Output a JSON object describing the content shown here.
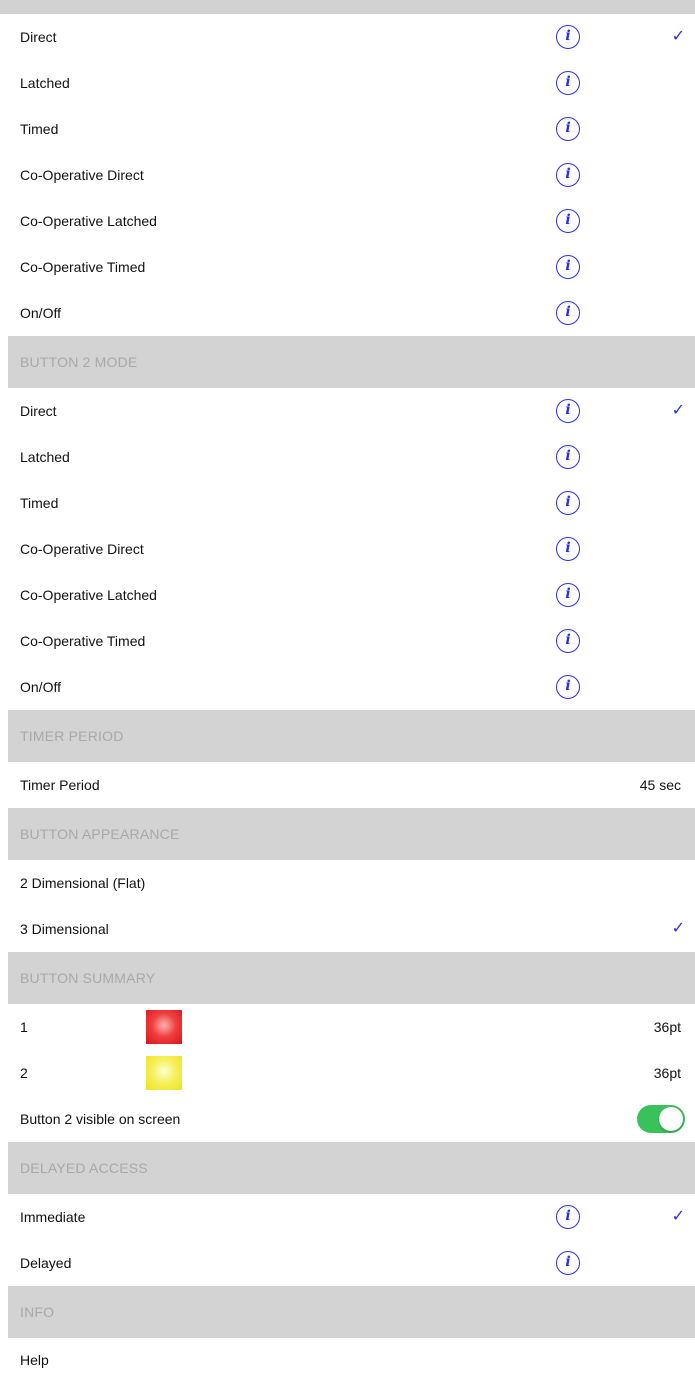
{
  "button1_mode": {
    "items": [
      {
        "label": "Direct",
        "checked": true
      },
      {
        "label": "Latched",
        "checked": false
      },
      {
        "label": "Timed",
        "checked": false
      },
      {
        "label": "Co-Operative Direct",
        "checked": false
      },
      {
        "label": "Co-Operative Latched",
        "checked": false
      },
      {
        "label": "Co-Operative Timed",
        "checked": false
      },
      {
        "label": "On/Off",
        "checked": false
      }
    ]
  },
  "button2_mode": {
    "header": "BUTTON 2 MODE",
    "items": [
      {
        "label": "Direct",
        "checked": true
      },
      {
        "label": "Latched",
        "checked": false
      },
      {
        "label": "Timed",
        "checked": false
      },
      {
        "label": "Co-Operative Direct",
        "checked": false
      },
      {
        "label": "Co-Operative Latched",
        "checked": false
      },
      {
        "label": "Co-Operative Timed",
        "checked": false
      },
      {
        "label": "On/Off",
        "checked": false
      }
    ]
  },
  "timer_period": {
    "header": "TIMER PERIOD",
    "label": "Timer Period",
    "value": "45 sec"
  },
  "button_appearance": {
    "header": "BUTTON APPEARANCE",
    "items": [
      {
        "label": "2 Dimensional (Flat)",
        "checked": false
      },
      {
        "label": "3 Dimensional",
        "checked": true
      }
    ]
  },
  "button_summary": {
    "header": "BUTTON SUMMARY",
    "buttons": [
      {
        "label": "1",
        "size": "36pt",
        "color": "#e8232a"
      },
      {
        "label": "2",
        "size": "36pt",
        "color": "#f2ec2a"
      }
    ],
    "visible_label": "Button 2 visible on screen",
    "visible_on": true
  },
  "delayed_access": {
    "header": "DELAYED ACCESS",
    "items": [
      {
        "label": "Immediate",
        "checked": true
      },
      {
        "label": "Delayed",
        "checked": false
      }
    ]
  },
  "info": {
    "header": "INFO",
    "help_label": "Help"
  },
  "icons": {
    "info_glyph": "i",
    "check_glyph": "✓"
  },
  "colors": {
    "accent": "#2a2ef0",
    "header_bg": "#d3d3d3",
    "header_text": "#a8a8a8",
    "toggle_on": "#39c25a"
  }
}
